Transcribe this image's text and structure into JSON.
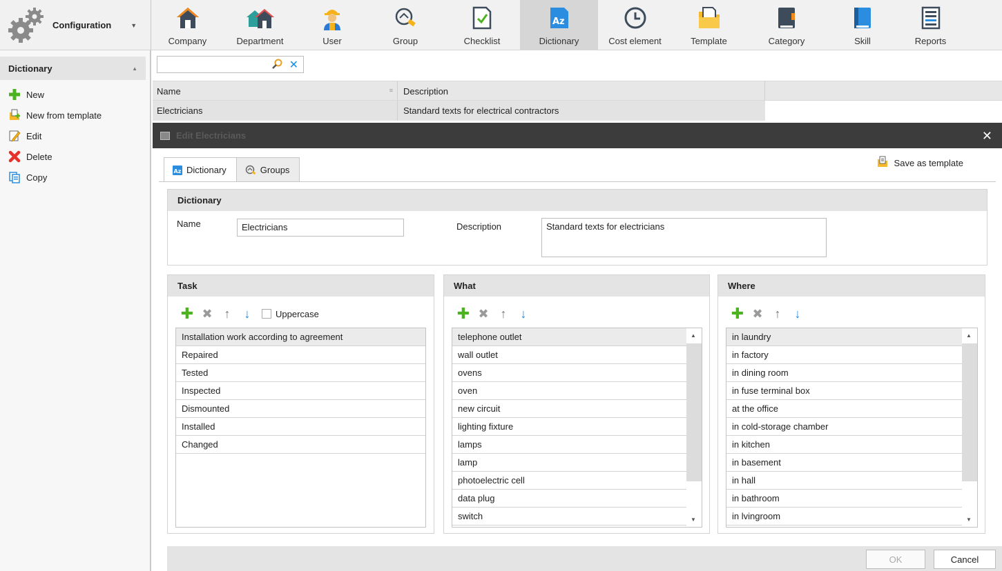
{
  "app": {
    "module_title": "Configuration"
  },
  "nav": [
    {
      "label": "Company",
      "icon": "house-icon"
    },
    {
      "label": "Department",
      "icon": "houses-icon"
    },
    {
      "label": "User",
      "icon": "worker-icon"
    },
    {
      "label": "Group",
      "icon": "group-icon"
    },
    {
      "label": "Checklist",
      "icon": "checklist-icon"
    },
    {
      "label": "Dictionary",
      "icon": "dictionary-icon",
      "active": true
    },
    {
      "label": "Cost element",
      "icon": "clock-icon"
    },
    {
      "label": "Template",
      "icon": "template-folder-icon"
    },
    {
      "label": "Category",
      "icon": "category-book-icon"
    },
    {
      "label": "Skill",
      "icon": "skill-book-icon"
    },
    {
      "label": "Reports",
      "icon": "reports-icon"
    }
  ],
  "sidebar": {
    "header": "Dictionary",
    "actions": [
      {
        "label": "New",
        "icon": "plus-icon"
      },
      {
        "label": "New from template",
        "icon": "new-from-template-icon"
      },
      {
        "label": "Edit",
        "icon": "edit-icon"
      },
      {
        "label": "Delete",
        "icon": "delete-icon"
      },
      {
        "label": "Copy",
        "icon": "copy-icon"
      }
    ]
  },
  "search": {
    "value": "",
    "placeholder": ""
  },
  "grid": {
    "columns": [
      "Name",
      "Description"
    ],
    "rows": [
      [
        "Electricians",
        "Standard texts for electrical contractors"
      ]
    ]
  },
  "dialog": {
    "title": "Edit Electricians",
    "tabs": [
      "Dictionary",
      "Groups"
    ],
    "save_as_template": "Save as template",
    "section_title": "Dictionary",
    "name_label": "Name",
    "name_value": "Electricians",
    "description_label": "Description",
    "description_value": "Standard texts for electricians",
    "task": {
      "title": "Task",
      "uppercase_label": "Uppercase",
      "items": [
        "Installation work according to agreement",
        "Repaired",
        "Tested",
        "Inspected",
        "Dismounted",
        "Installed",
        "Changed"
      ]
    },
    "what": {
      "title": "What",
      "items": [
        "telephone outlet",
        "wall outlet",
        "ovens",
        "oven",
        "new circuit",
        "lighting fixture",
        "lamps",
        "lamp",
        "photoelectric cell",
        "data plug",
        "switch"
      ]
    },
    "where": {
      "title": "Where",
      "items": [
        "in laundry",
        "in factory",
        "in dining room",
        "in fuse terminal box",
        "at the office",
        "in cold-storage chamber",
        "in kitchen",
        "in basement",
        "in hall",
        "in bathroom",
        "in lvingroom"
      ]
    },
    "ok_label": "OK",
    "cancel_label": "Cancel"
  },
  "colors": {
    "accent": "#1a88e8",
    "add_green": "#4bb31f",
    "delete_red": "#e8302a",
    "titlebar": "#3c3c3c"
  }
}
